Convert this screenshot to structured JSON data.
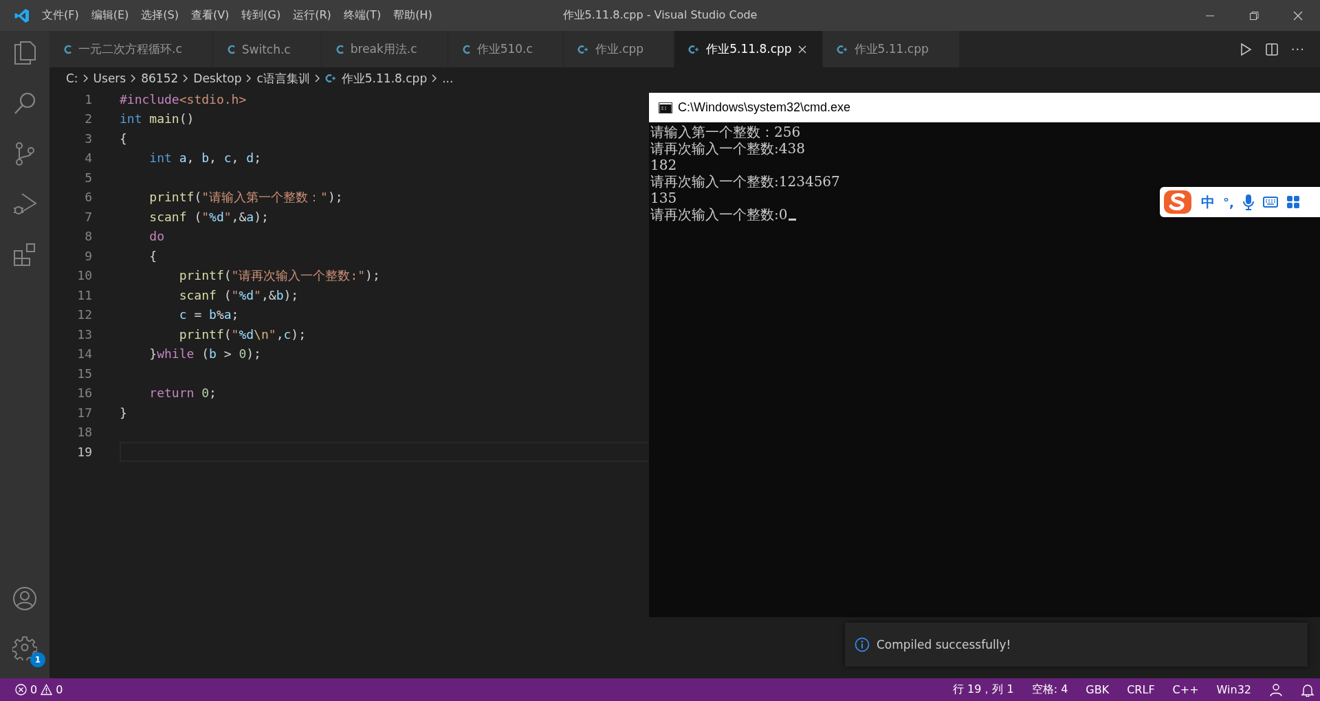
{
  "window": {
    "title": "作业5.11.8.cpp - Visual Studio Code"
  },
  "menu": [
    "文件(F)",
    "编辑(E)",
    "选择(S)",
    "查看(V)",
    "转到(G)",
    "运行(R)",
    "终端(T)",
    "帮助(H)"
  ],
  "activity_bar": {
    "items": [
      {
        "kind": "explorer",
        "selected": false
      },
      {
        "kind": "search",
        "selected": false
      },
      {
        "kind": "source-control",
        "selected": false
      },
      {
        "kind": "run",
        "selected": false
      },
      {
        "kind": "extensions",
        "selected": false
      }
    ],
    "settings_badge": "1"
  },
  "tabs": [
    {
      "label": "一元二次方程循环.c",
      "kind": "c",
      "selected": false
    },
    {
      "label": "Switch.c",
      "kind": "c",
      "selected": false
    },
    {
      "label": "break用法.c",
      "kind": "c",
      "selected": false
    },
    {
      "label": "作业510.c",
      "kind": "c",
      "selected": false
    },
    {
      "label": "作业.cpp",
      "kind": "cpp",
      "selected": false
    },
    {
      "label": "作业5.11.8.cpp",
      "kind": "cpp",
      "selected": true
    },
    {
      "label": "作业5.11.cpp",
      "kind": "cpp",
      "selected": false
    }
  ],
  "tab_actions": {
    "more": "···"
  },
  "breadcrumb": [
    {
      "label": "C:",
      "kind": "folder"
    },
    {
      "label": "Users",
      "kind": "folder"
    },
    {
      "label": "86152",
      "kind": "folder"
    },
    {
      "label": "Desktop",
      "kind": "folder"
    },
    {
      "label": "c语言集训",
      "kind": "folder"
    },
    {
      "label": "作业5.11.8.cpp",
      "kind": "cpp"
    },
    {
      "label": "...",
      "kind": "symbol"
    }
  ],
  "code": [
    {
      "number": "1",
      "current": false,
      "tokens": [
        {
          "kind": "directive",
          "text": "#include"
        },
        {
          "kind": "string",
          "text": "<stdio.h>"
        }
      ]
    },
    {
      "number": "2",
      "current": false,
      "tokens": [
        {
          "kind": "keyword",
          "text": "int"
        },
        {
          "kind": "function",
          "text": " main"
        },
        {
          "kind": "plain",
          "text": "()"
        }
      ]
    },
    {
      "number": "3",
      "current": false,
      "tokens": [
        {
          "kind": "plain",
          "text": "{"
        }
      ]
    },
    {
      "number": "4",
      "current": false,
      "tokens": [
        {
          "kind": "keyword",
          "text": "    int"
        },
        {
          "kind": "variable",
          "text": " a"
        },
        {
          "kind": "plain",
          "text": ", "
        },
        {
          "kind": "variable",
          "text": "b"
        },
        {
          "kind": "plain",
          "text": ", "
        },
        {
          "kind": "variable",
          "text": "c"
        },
        {
          "kind": "plain",
          "text": ", "
        },
        {
          "kind": "variable",
          "text": "d"
        },
        {
          "kind": "plain",
          "text": ";"
        }
      ]
    },
    {
      "number": "5",
      "current": false
    },
    {
      "number": "6",
      "current": false,
      "tokens": [
        {
          "kind": "function",
          "text": "    printf"
        },
        {
          "kind": "plain",
          "text": "("
        },
        {
          "kind": "string",
          "text": "\"请输入第一个整数：\""
        },
        {
          "kind": "plain",
          "text": ");"
        }
      ]
    },
    {
      "number": "7",
      "current": false,
      "tokens": [
        {
          "kind": "function",
          "text": "    scanf"
        },
        {
          "kind": "plain",
          "text": " ("
        },
        {
          "kind": "string",
          "text": "\""
        },
        {
          "kind": "variable",
          "text": "%d"
        },
        {
          "kind": "string",
          "text": "\""
        },
        {
          "kind": "plain",
          "text": ",&"
        },
        {
          "kind": "variable",
          "text": "a"
        },
        {
          "kind": "plain",
          "text": ");"
        }
      ]
    },
    {
      "number": "8",
      "current": false,
      "tokens": [
        {
          "kind": "directive",
          "text": "    do"
        }
      ]
    },
    {
      "number": "9",
      "current": false,
      "tokens": [
        {
          "kind": "plain",
          "text": "    {"
        }
      ]
    },
    {
      "number": "10",
      "current": false,
      "tokens": [
        {
          "kind": "function",
          "text": "        printf"
        },
        {
          "kind": "plain",
          "text": "("
        },
        {
          "kind": "string",
          "text": "\"请再次输入一个整数:\""
        },
        {
          "kind": "plain",
          "text": ");"
        }
      ]
    },
    {
      "number": "11",
      "current": false,
      "tokens": [
        {
          "kind": "function",
          "text": "        scanf"
        },
        {
          "kind": "plain",
          "text": " ("
        },
        {
          "kind": "string",
          "text": "\""
        },
        {
          "kind": "variable",
          "text": "%d"
        },
        {
          "kind": "string",
          "text": "\""
        },
        {
          "kind": "plain",
          "text": ",&"
        },
        {
          "kind": "variable",
          "text": "b"
        },
        {
          "kind": "plain",
          "text": ");"
        }
      ]
    },
    {
      "number": "12",
      "current": false,
      "tokens": [
        {
          "kind": "variable",
          "text": "        c"
        },
        {
          "kind": "plain",
          "text": " = "
        },
        {
          "kind": "variable",
          "text": "b"
        },
        {
          "kind": "plain",
          "text": "%"
        },
        {
          "kind": "variable",
          "text": "a"
        },
        {
          "kind": "plain",
          "text": ";"
        }
      ]
    },
    {
      "number": "13",
      "current": false,
      "tokens": [
        {
          "kind": "function",
          "text": "        printf"
        },
        {
          "kind": "plain",
          "text": "("
        },
        {
          "kind": "string",
          "text": "\""
        },
        {
          "kind": "variable",
          "text": "%d"
        },
        {
          "kind": "escape",
          "text": "\\n"
        },
        {
          "kind": "string",
          "text": "\""
        },
        {
          "kind": "plain",
          "text": ","
        },
        {
          "kind": "variable",
          "text": "c"
        },
        {
          "kind": "plain",
          "text": ");"
        }
      ]
    },
    {
      "number": "14",
      "current": false,
      "tokens": [
        {
          "kind": "plain",
          "text": "    }"
        },
        {
          "kind": "directive",
          "text": "while"
        },
        {
          "kind": "plain",
          "text": " ("
        },
        {
          "kind": "variable",
          "text": "b"
        },
        {
          "kind": "plain",
          "text": " > "
        },
        {
          "kind": "number",
          "text": "0"
        },
        {
          "kind": "plain",
          "text": ");"
        }
      ]
    },
    {
      "number": "15",
      "current": false
    },
    {
      "number": "16",
      "current": false,
      "tokens": [
        {
          "kind": "directive",
          "text": "    return"
        },
        {
          "kind": "number",
          "text": " 0"
        },
        {
          "kind": "plain",
          "text": ";"
        }
      ]
    },
    {
      "number": "17",
      "current": false,
      "tokens": [
        {
          "kind": "plain",
          "text": "}"
        }
      ]
    },
    {
      "number": "18",
      "current": false
    },
    {
      "number": "19",
      "current": true
    }
  ],
  "console_window": {
    "title": "C:\\Windows\\system32\\cmd.exe",
    "lines": [
      "请输入第一个整数：256",
      "请再次输入一个整数:438",
      "182",
      "请再次输入一个整数:1234567",
      "135",
      "请再次输入一个整数:0"
    ],
    "cursor": true
  },
  "ime_toolbar": {
    "mode": "中",
    "punctuation": "°,"
  },
  "notification": {
    "message": "Compiled successfully!"
  },
  "status_bar": {
    "errors": "0",
    "warnings": "0",
    "items": [
      "行 19，列 1",
      "空格: 4",
      "GBK",
      "CRLF",
      "C++",
      "Win32"
    ]
  }
}
